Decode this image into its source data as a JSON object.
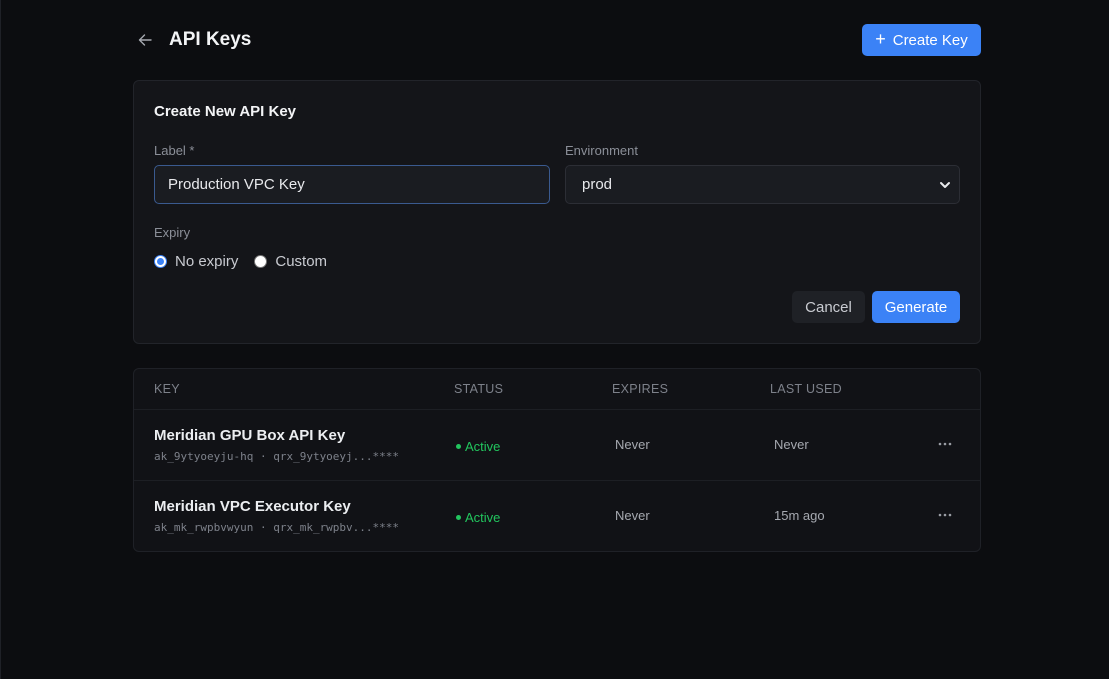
{
  "header": {
    "title": "API Keys",
    "create_button": "Create Key"
  },
  "form": {
    "title": "Create New API Key",
    "label_field": {
      "label": "Label *",
      "value": "Production VPC Key"
    },
    "environment_field": {
      "label": "Environment",
      "value": "prod"
    },
    "expiry": {
      "label": "Expiry",
      "options": [
        "No expiry",
        "Custom"
      ],
      "selected": "No expiry"
    },
    "cancel": "Cancel",
    "generate": "Generate"
  },
  "table": {
    "columns": [
      "KEY",
      "STATUS",
      "EXPIRES",
      "LAST USED"
    ],
    "rows": [
      {
        "name": "Meridian GPU Box API Key",
        "sub": "ak_9ytyoeyju-hq · qrx_9ytyoeyj...****",
        "status": "Active",
        "expires": "Never",
        "last_used": "Never"
      },
      {
        "name": "Meridian VPC Executor Key",
        "sub": "ak_mk_rwpbvwyun · qrx_mk_rwpbv...****",
        "status": "Active",
        "expires": "Never",
        "last_used": "15m ago"
      }
    ]
  },
  "colors": {
    "accent": "#3b82f6",
    "active": "#22c55e",
    "background": "#0c0d10"
  }
}
